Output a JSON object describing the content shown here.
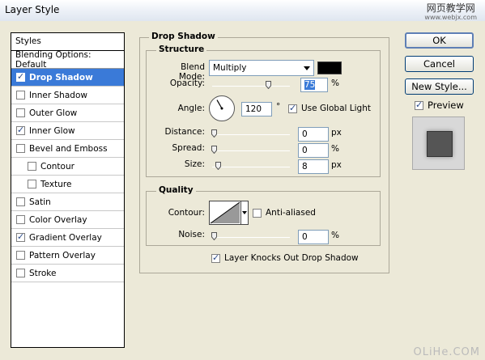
{
  "window": {
    "title": "Layer Style",
    "watermark_top": "网页教学网",
    "watermark_sub": "www.webjx.com",
    "watermark_bottom": "OLiHe.COM"
  },
  "styles_panel": {
    "header": "Styles",
    "items": [
      {
        "label": "Blending Options: Default",
        "has_checkbox": false,
        "checked": false,
        "selected": false,
        "sub": false
      },
      {
        "label": "Drop Shadow",
        "has_checkbox": true,
        "checked": true,
        "selected": true,
        "sub": false
      },
      {
        "label": "Inner Shadow",
        "has_checkbox": true,
        "checked": false,
        "selected": false,
        "sub": false
      },
      {
        "label": "Outer Glow",
        "has_checkbox": true,
        "checked": false,
        "selected": false,
        "sub": false
      },
      {
        "label": "Inner Glow",
        "has_checkbox": true,
        "checked": true,
        "selected": false,
        "sub": false
      },
      {
        "label": "Bevel and Emboss",
        "has_checkbox": true,
        "checked": false,
        "selected": false,
        "sub": false
      },
      {
        "label": "Contour",
        "has_checkbox": true,
        "checked": false,
        "selected": false,
        "sub": true
      },
      {
        "label": "Texture",
        "has_checkbox": true,
        "checked": false,
        "selected": false,
        "sub": true
      },
      {
        "label": "Satin",
        "has_checkbox": true,
        "checked": false,
        "selected": false,
        "sub": false
      },
      {
        "label": "Color Overlay",
        "has_checkbox": true,
        "checked": false,
        "selected": false,
        "sub": false
      },
      {
        "label": "Gradient Overlay",
        "has_checkbox": true,
        "checked": true,
        "selected": false,
        "sub": false
      },
      {
        "label": "Pattern Overlay",
        "has_checkbox": true,
        "checked": false,
        "selected": false,
        "sub": false
      },
      {
        "label": "Stroke",
        "has_checkbox": true,
        "checked": false,
        "selected": false,
        "sub": false
      }
    ]
  },
  "drop_shadow": {
    "title": "Drop Shadow",
    "structure": {
      "title": "Structure",
      "blend_mode_label": "Blend Mode:",
      "blend_mode_value": "Multiply",
      "shadow_color": "#000000",
      "opacity_label": "Opacity:",
      "opacity_value": "75",
      "opacity_unit": "%",
      "opacity_level": 0.75,
      "angle_label": "Angle:",
      "angle_value": "120",
      "angle_unit": "°",
      "angle_degrees": 120,
      "global_light_label": "Use Global Light",
      "global_light_checked": true,
      "distance_label": "Distance:",
      "distance_value": "0",
      "distance_unit": "px",
      "distance_level": 0,
      "spread_label": "Spread:",
      "spread_value": "0",
      "spread_unit": "%",
      "spread_level": 0,
      "size_label": "Size:",
      "size_value": "8",
      "size_unit": "px",
      "size_level": 0.06
    },
    "quality": {
      "title": "Quality",
      "contour_label": "Contour:",
      "antialiased_label": "Anti-aliased",
      "antialiased_checked": false,
      "noise_label": "Noise:",
      "noise_value": "0",
      "noise_unit": "%",
      "noise_level": 0
    },
    "knockout_label": "Layer Knocks Out Drop Shadow",
    "knockout_checked": true
  },
  "buttons": {
    "ok": "OK",
    "cancel": "Cancel",
    "new_style": "New Style...",
    "preview_label": "Preview",
    "preview_checked": true
  },
  "colors": {
    "selection": "#3a7ad8",
    "preview_swatch": "#555555"
  }
}
